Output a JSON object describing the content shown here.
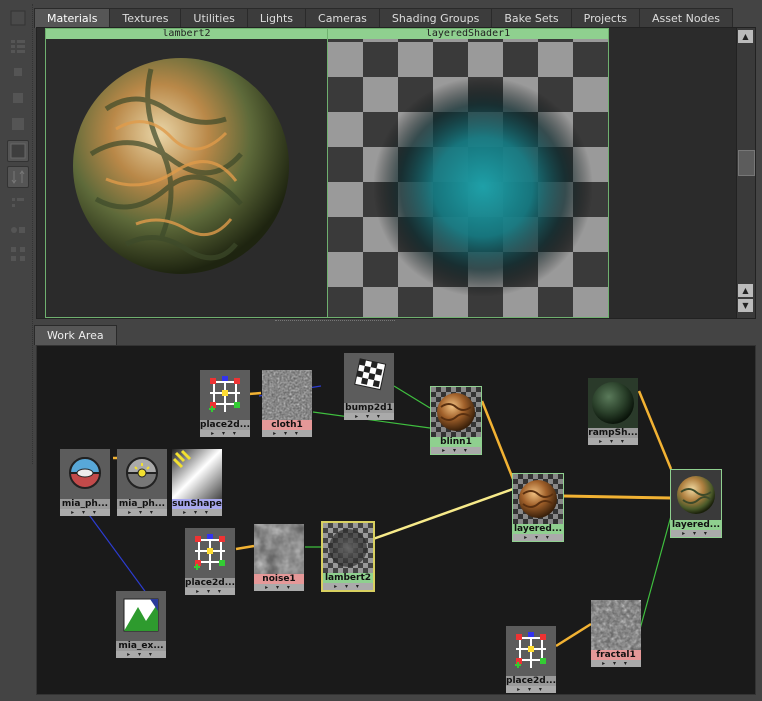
{
  "tabs": [
    {
      "label": "Materials"
    },
    {
      "label": "Textures"
    },
    {
      "label": "Utilities"
    },
    {
      "label": "Lights"
    },
    {
      "label": "Cameras"
    },
    {
      "label": "Shading Groups"
    },
    {
      "label": "Bake Sets"
    },
    {
      "label": "Projects"
    },
    {
      "label": "Asset Nodes"
    }
  ],
  "swatches": [
    {
      "label": "lambert2"
    },
    {
      "label": "layeredShader1"
    }
  ],
  "work_area": {
    "tab_label": "Work Area"
  },
  "nodes": {
    "place2d_a": "place2d...",
    "cloth1": "cloth1",
    "bump2d1": "bump2d1",
    "blinn1": "blinn1",
    "mia_ph_1": "mia_ph...",
    "mia_ph_2": "mia_ph...",
    "sunShape": "sunShape",
    "rampSh": "rampSh...",
    "layered_mid": "layered...",
    "layered_right": "layered...",
    "place2d_b": "place2d...",
    "noise1": "noise1",
    "lambert2": "lambert2",
    "mia_ex": "mia_ex...",
    "fractal1": "fractal1",
    "place2d_c": "place2d..."
  },
  "node_port_glyphs": "▸ ▾ ▾",
  "colors": {
    "accent_green": "#8fd08f",
    "texture_red": "#e59898",
    "light_blue": "#a8a8ee",
    "wire_yellow": "#f2b233",
    "wire_green": "#3fbf3f",
    "wire_blue": "#2c3cd0"
  }
}
